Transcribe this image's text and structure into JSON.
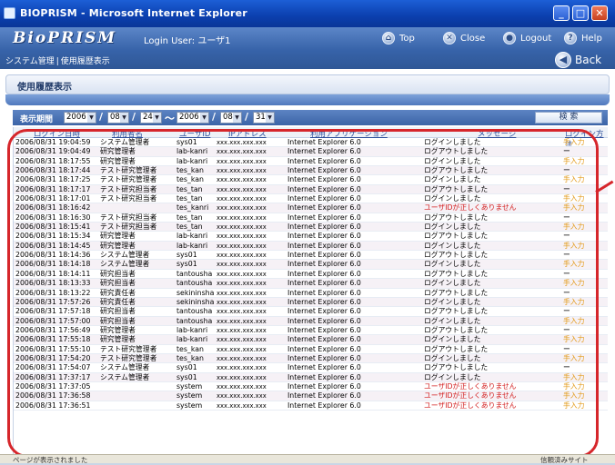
{
  "window": {
    "title": "BIOPRISM - Microsoft Internet Explorer"
  },
  "header": {
    "logo": "BioPRISM",
    "login_label": "Login User:",
    "login_user": "ユーザ1",
    "buttons": {
      "top": "Top",
      "close": "Close",
      "logout": "Logout",
      "help": "Help"
    },
    "breadcrumb": [
      "システム管理",
      "使用履歴表示"
    ],
    "back": "Back"
  },
  "page": {
    "section_title": "使用履歴表示"
  },
  "filter": {
    "label": "表示期間",
    "from": {
      "year": "2006",
      "month": "08",
      "day": "24"
    },
    "to": {
      "year": "2006",
      "month": "08",
      "day": "31"
    },
    "search_button": "検 索"
  },
  "table": {
    "headers": [
      "ログイン日時",
      "利用者名",
      "ユーザID",
      "IPアドレス",
      "利用アプリケーション",
      "メッセージ",
      "ログイン方法"
    ],
    "rows": [
      [
        "2006/08/31 19:04:59",
        "システム管理者",
        "sys01",
        "xxx.xxx.xxx.xxx",
        "Internet Explorer 6.0",
        "ログインしました",
        "手入力"
      ],
      [
        "2006/08/31 19:04:49",
        "研究管理者",
        "lab-kanri",
        "xxx.xxx.xxx.xxx",
        "Internet Explorer 6.0",
        "ログアウトしました",
        "ー"
      ],
      [
        "2006/08/31 18:17:55",
        "研究管理者",
        "lab-kanri",
        "xxx.xxx.xxx.xxx",
        "Internet Explorer 6.0",
        "ログインしました",
        "手入力"
      ],
      [
        "2006/08/31 18:17:44",
        "テスト研究管理者",
        "tes_kan",
        "xxx.xxx.xxx.xxx",
        "Internet Explorer 6.0",
        "ログアウトしました",
        "ー"
      ],
      [
        "2006/08/31 18:17:25",
        "テスト研究管理者",
        "tes_kan",
        "xxx.xxx.xxx.xxx",
        "Internet Explorer 6.0",
        "ログインしました",
        "手入力"
      ],
      [
        "2006/08/31 18:17:17",
        "テスト研究担当者",
        "tes_tan",
        "xxx.xxx.xxx.xxx",
        "Internet Explorer 6.0",
        "ログアウトしました",
        "ー"
      ],
      [
        "2006/08/31 18:17:01",
        "テスト研究担当者",
        "tes_tan",
        "xxx.xxx.xxx.xxx",
        "Internet Explorer 6.0",
        "ログインしました",
        "手入力"
      ],
      [
        "2006/08/31 18:16:42",
        "",
        "tes_kanri",
        "xxx.xxx.xxx.xxx",
        "Internet Explorer 6.0",
        "ユーザIDが正しくありません",
        "手入力"
      ],
      [
        "2006/08/31 18:16:30",
        "テスト研究担当者",
        "tes_tan",
        "xxx.xxx.xxx.xxx",
        "Internet Explorer 6.0",
        "ログアウトしました",
        "ー"
      ],
      [
        "2006/08/31 18:15:41",
        "テスト研究担当者",
        "tes_tan",
        "xxx.xxx.xxx.xxx",
        "Internet Explorer 6.0",
        "ログインしました",
        "手入力"
      ],
      [
        "2006/08/31 18:15:34",
        "研究管理者",
        "lab-kanri",
        "xxx.xxx.xxx.xxx",
        "Internet Explorer 6.0",
        "ログアウトしました",
        "ー"
      ],
      [
        "2006/08/31 18:14:45",
        "研究管理者",
        "lab-kanri",
        "xxx.xxx.xxx.xxx",
        "Internet Explorer 6.0",
        "ログインしました",
        "手入力"
      ],
      [
        "2006/08/31 18:14:36",
        "システム管理者",
        "sys01",
        "xxx.xxx.xxx.xxx",
        "Internet Explorer 6.0",
        "ログアウトしました",
        "ー"
      ],
      [
        "2006/08/31 18:14:18",
        "システム管理者",
        "sys01",
        "xxx.xxx.xxx.xxx",
        "Internet Explorer 6.0",
        "ログインしました",
        "手入力"
      ],
      [
        "2006/08/31 18:14:11",
        "研究担当者",
        "tantousha",
        "xxx.xxx.xxx.xxx",
        "Internet Explorer 6.0",
        "ログアウトしました",
        "ー"
      ],
      [
        "2006/08/31 18:13:33",
        "研究担当者",
        "tantousha",
        "xxx.xxx.xxx.xxx",
        "Internet Explorer 6.0",
        "ログインしました",
        "手入力"
      ],
      [
        "2006/08/31 18:13:22",
        "研究責任者",
        "sekininsha",
        "xxx.xxx.xxx.xxx",
        "Internet Explorer 6.0",
        "ログアウトしました",
        "ー"
      ],
      [
        "2006/08/31 17:57:26",
        "研究責任者",
        "sekininsha",
        "xxx.xxx.xxx.xxx",
        "Internet Explorer 6.0",
        "ログインしました",
        "手入力"
      ],
      [
        "2006/08/31 17:57:18",
        "研究担当者",
        "tantousha",
        "xxx.xxx.xxx.xxx",
        "Internet Explorer 6.0",
        "ログアウトしました",
        "ー"
      ],
      [
        "2006/08/31 17:57:00",
        "研究担当者",
        "tantousha",
        "xxx.xxx.xxx.xxx",
        "Internet Explorer 6.0",
        "ログインしました",
        "手入力"
      ],
      [
        "2006/08/31 17:56:49",
        "研究管理者",
        "lab-kanri",
        "xxx.xxx.xxx.xxx",
        "Internet Explorer 6.0",
        "ログアウトしました",
        "ー"
      ],
      [
        "2006/08/31 17:55:18",
        "研究管理者",
        "lab-kanri",
        "xxx.xxx.xxx.xxx",
        "Internet Explorer 6.0",
        "ログインしました",
        "手入力"
      ],
      [
        "2006/08/31 17:55:10",
        "テスト研究管理者",
        "tes_kan",
        "xxx.xxx.xxx.xxx",
        "Internet Explorer 6.0",
        "ログアウトしました",
        "ー"
      ],
      [
        "2006/08/31 17:54:20",
        "テスト研究管理者",
        "tes_kan",
        "xxx.xxx.xxx.xxx",
        "Internet Explorer 6.0",
        "ログインしました",
        "手入力"
      ],
      [
        "2006/08/31 17:54:07",
        "システム管理者",
        "sys01",
        "xxx.xxx.xxx.xxx",
        "Internet Explorer 6.0",
        "ログアウトしました",
        "ー"
      ],
      [
        "2006/08/31 17:37:17",
        "システム管理者",
        "sys01",
        "xxx.xxx.xxx.xxx",
        "Internet Explorer 6.0",
        "ログインしました",
        "手入力"
      ],
      [
        "2006/08/31 17:37:05",
        "",
        "system",
        "xxx.xxx.xxx.xxx",
        "Internet Explorer 6.0",
        "ユーザIDが正しくありません",
        "手入力"
      ],
      [
        "2006/08/31 17:36:58",
        "",
        "system",
        "xxx.xxx.xxx.xxx",
        "Internet Explorer 6.0",
        "ユーザIDが正しくありません",
        "手入力"
      ],
      [
        "2006/08/31 17:36:51",
        "",
        "system",
        "xxx.xxx.xxx.xxx",
        "Internet Explorer 6.0",
        "ユーザIDが正しくありません",
        "手入力"
      ]
    ]
  },
  "statusbar": {
    "left": "ページが表示されました",
    "right": "信頼済みサイト"
  },
  "colors": {
    "accent": "#3763a9",
    "error": "#d21c1c",
    "manual": "#e39b1a",
    "highlight": "#d6262b"
  }
}
